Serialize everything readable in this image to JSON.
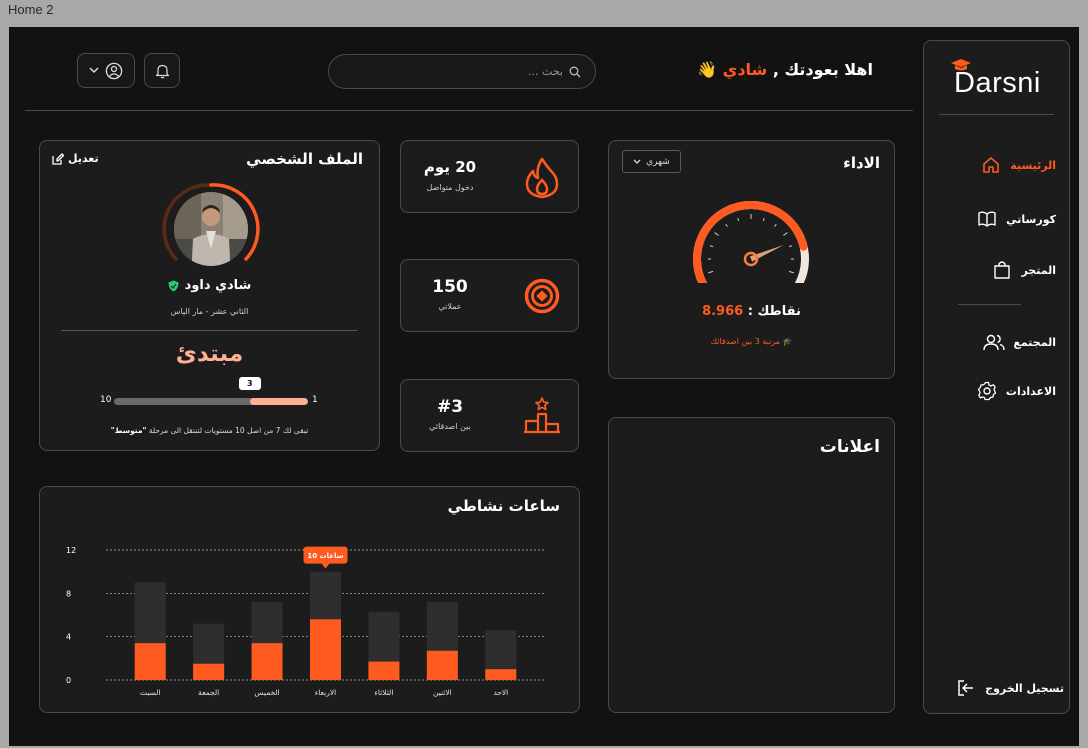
{
  "frame_label": "Home 2",
  "brand": {
    "name": "Darsni",
    "accent": "#ff5a1f",
    "accent_light": "#ffb092"
  },
  "sidebar": {
    "items": [
      {
        "label": "الرئيسية",
        "icon": "home-icon",
        "active": true
      },
      {
        "label": "كورساتي",
        "icon": "book-icon",
        "active": false
      },
      {
        "label": "المتجر",
        "icon": "shopping-bag-icon",
        "active": false
      },
      {
        "label": "المجتمع",
        "icon": "users-icon",
        "active": false
      },
      {
        "label": "الاعدادات",
        "icon": "gear-icon",
        "active": false
      }
    ],
    "logout": {
      "label": "تسجيل الخروج",
      "icon": "logout-icon"
    }
  },
  "header": {
    "greeting_prefix": "اهلا بعودتك ,",
    "greeting_name": "شادي",
    "greeting_emoji": "👋",
    "search_placeholder": "بحث ...",
    "notification_icon": "bell-icon",
    "account_icon": "user-circle-icon"
  },
  "performance": {
    "title": "الاداء",
    "period": "شهري",
    "points_label": "نقاطك :",
    "points_value": "8.966",
    "rank_text": "مرتبة 3 بين اصدقائك",
    "gauge_fraction": 0.82
  },
  "ads": {
    "title": "اعلانات"
  },
  "stats": [
    {
      "value": "20 يوم",
      "label": "دخول متواصل",
      "icon": "flame-icon"
    },
    {
      "value": "150",
      "label": "عملاتي",
      "icon": "coin-icon"
    },
    {
      "value": "#3",
      "label": "بين اصدقائي",
      "icon": "podium-icon"
    }
  ],
  "profile": {
    "title": "الملف الشخصي",
    "edit_label": "تعديل",
    "name": "شادي داود",
    "grade": "الثاني عشر - مار الياس",
    "level": "مبتدئ",
    "progress_min": "1",
    "progress_max": "10",
    "progress_current": "3",
    "progress_fraction": 0.3,
    "note_prefix": "تبقى لك 7 من اصل 10 مستويات لتنتقل الى مرحلة",
    "note_level": "\"متوسط\""
  },
  "chart_data": {
    "type": "bar",
    "title": "ساعات نشاطي",
    "categories": [
      "السبت",
      "الجمعة",
      "الخميس",
      "الاربعاء",
      "الثلاثاء",
      "الاثنين",
      "الاحد"
    ],
    "series": [
      {
        "values": [
          3.4,
          1.5,
          3.4,
          5.6,
          1.7,
          2.7,
          1.0
        ],
        "color": "#ff5a1f"
      },
      {
        "values": [
          9.0,
          5.2,
          7.2,
          10.0,
          6.3,
          7.2,
          4.6
        ],
        "color": "#2e2e2e"
      }
    ],
    "yticks": [
      "0",
      "4",
      "8",
      "12"
    ],
    "ylim": [
      0,
      12
    ],
    "grid": true,
    "highlight_index": 3,
    "tooltip": "10 ساعات"
  }
}
